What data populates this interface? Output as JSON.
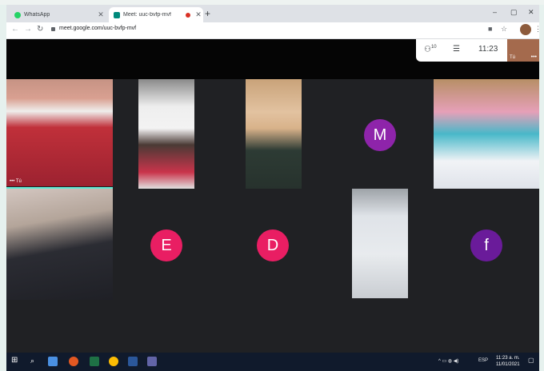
{
  "browser": {
    "tabs": [
      {
        "label": "WhatsApp",
        "favicon": "whatsapp-icon",
        "color": "#25d366"
      },
      {
        "label": "Meet: uuc-bvfp-mvf",
        "favicon": "meet-icon",
        "color": "#00897b"
      }
    ],
    "url": "meet.google.com/uuc-bvfp-mvf"
  },
  "meet": {
    "participants_count": "10",
    "time": "11:23",
    "self_label": "Tú",
    "avatars": [
      {
        "letter": "M",
        "color": "#8e24aa"
      },
      {
        "letter": "E",
        "color": "#e91e63"
      },
      {
        "letter": "D",
        "color": "#e91e63"
      },
      {
        "letter": "f",
        "color": "#6a1b9a"
      }
    ]
  },
  "taskbar": {
    "language": "ESP",
    "time": "11:23 a. m.",
    "date": "11/01/2021"
  }
}
